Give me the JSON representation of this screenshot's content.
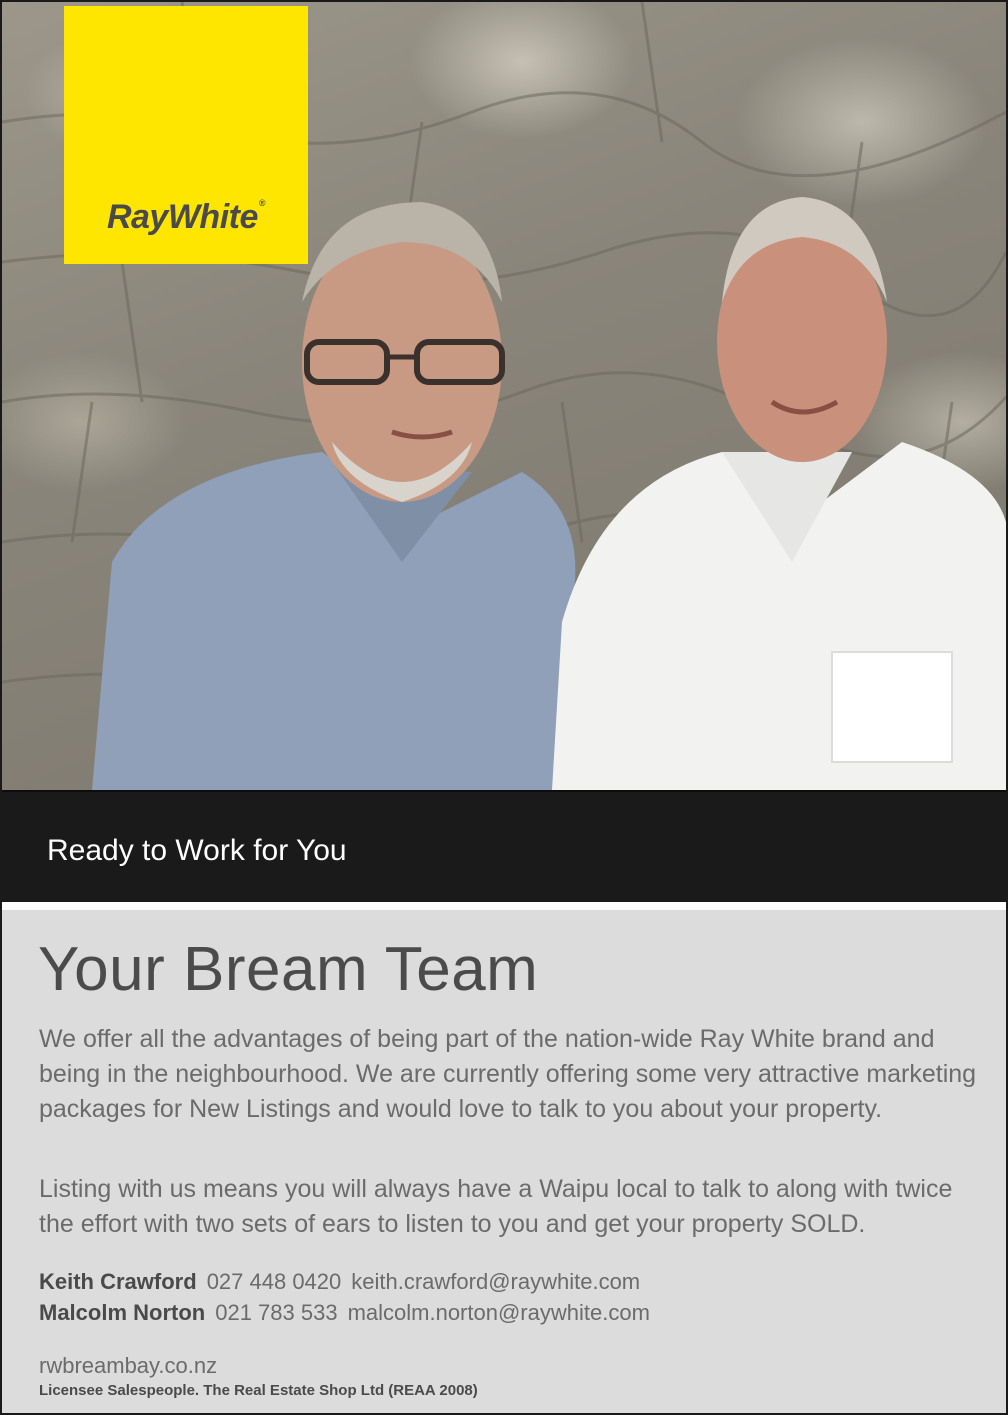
{
  "brand": {
    "logo_text": "RayWhite",
    "logo_registered": "®",
    "logo_color": "#ffe600"
  },
  "banner": {
    "text": "Ready to Work for You"
  },
  "headline": "Your Bream Team",
  "paragraphs": [
    "We offer all the advantages of being part of the nation-wide Ray White brand and being in the neighbourhood.  We are currently offering some very attractive marketing packages for New Listings and would love to talk to you about your property.",
    "Listing with us means you will always have a Waipu local to talk to along with twice the effort with two sets of ears to listen to you and get your property SOLD."
  ],
  "contacts": [
    {
      "name": "Keith Crawford",
      "phone": "027 448 0420",
      "email": "keith.crawford@raywhite.com"
    },
    {
      "name": "Malcolm Norton",
      "phone": "021 783 533",
      "email": "malcolm.norton@raywhite.com"
    }
  ],
  "website": "rwbreambay.co.nz",
  "license": "Licensee Salespeople.  The Real Estate Shop Ltd (REAA 2008)"
}
